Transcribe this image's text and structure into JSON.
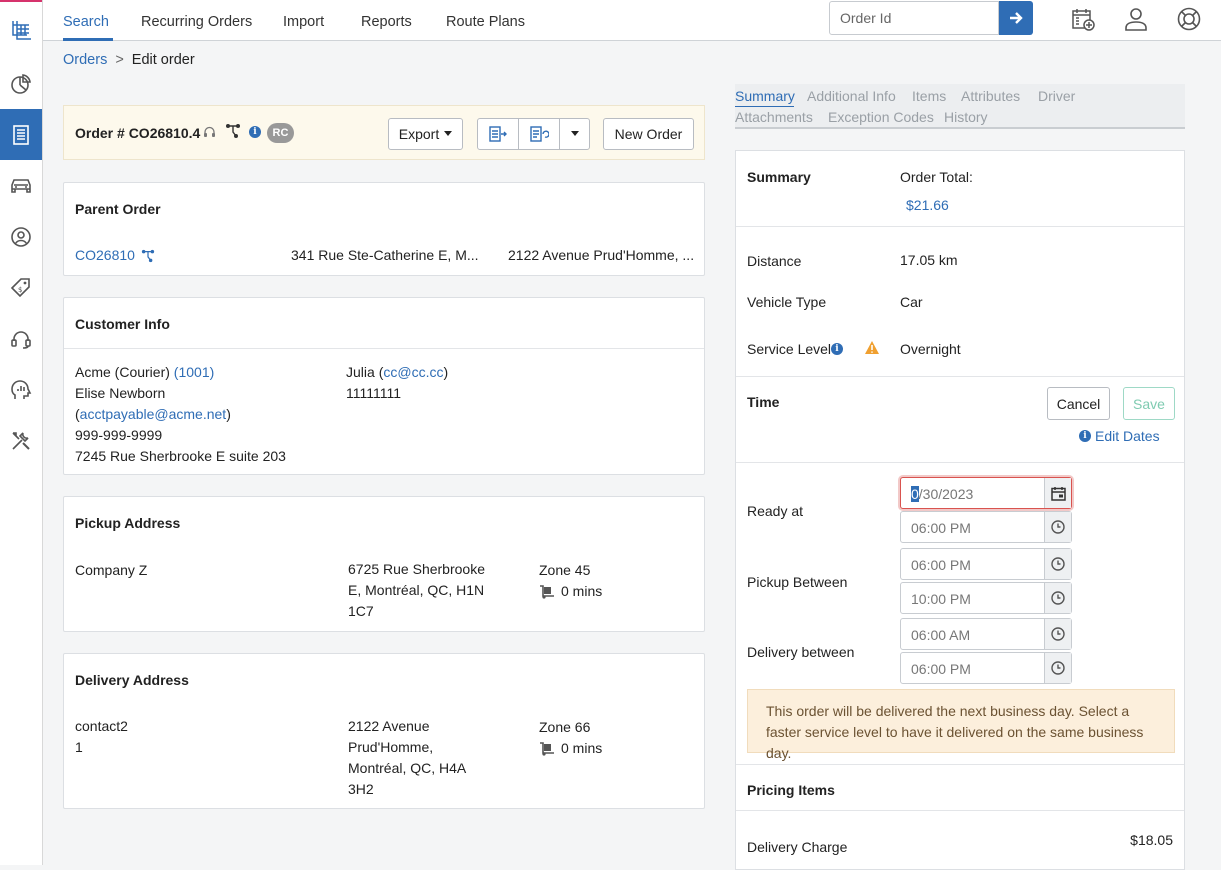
{
  "nav": {
    "tabs": [
      {
        "label": "Search"
      },
      {
        "label": "Recurring Orders"
      },
      {
        "label": "Import"
      },
      {
        "label": "Reports"
      },
      {
        "label": "Route Plans"
      }
    ],
    "order_id_placeholder": "Order Id"
  },
  "breadcrumb": {
    "root": "Orders",
    "separator": ">",
    "current": "Edit order"
  },
  "order_header": {
    "title": "Order # CO26810.4",
    "badge": "RC",
    "export_label": "Export",
    "new_order_label": "New Order"
  },
  "parent_order": {
    "heading": "Parent Order",
    "order_link": "CO26810",
    "pickup_address": "341 Rue Ste-Catherine E, M...",
    "delivery_address": "2122 Avenue Prud'Homme, ..."
  },
  "customer_info": {
    "heading": "Customer Info",
    "company": "Acme (Courier)",
    "account": "(1001)",
    "contact_name": "Elise Newborn",
    "email_open": "(",
    "email": "acctpayable@acme.net",
    "email_close": ")",
    "phone": "999-999-9999",
    "address": "7245 Rue Sherbrooke E suite 203",
    "caller_name": "Julia",
    "caller_open": "(",
    "caller_email": "cc@cc.cc",
    "caller_close": ")",
    "caller_phone": "11111111"
  },
  "pickup": {
    "heading": "Pickup Address",
    "name": "Company Z",
    "address_lines": [
      "6725 Rue Sherbrooke",
      "E, Montréal, QC, H1N",
      "1C7"
    ],
    "zone": "Zone 45",
    "wait": "0 mins"
  },
  "delivery": {
    "heading": "Delivery Address",
    "name": "contact2",
    "name_line2": "1",
    "address_lines": [
      "2122 Avenue",
      "Prud'Homme,",
      "Montréal, QC, H4A",
      "3H2"
    ],
    "zone": "Zone 66",
    "wait": "0 mins"
  },
  "right_tabs": [
    {
      "label": "Summary"
    },
    {
      "label": "Additional Info"
    },
    {
      "label": "Items"
    },
    {
      "label": "Attributes"
    },
    {
      "label": "Driver"
    },
    {
      "label": "Attachments"
    },
    {
      "label": "Exception Codes"
    },
    {
      "label": "History"
    }
  ],
  "summary": {
    "heading": "Summary",
    "order_total_label": "Order Total:",
    "order_total": "$21.66",
    "distance_label": "Distance",
    "distance": "17.05 km",
    "vehicle_label": "Vehicle Type",
    "vehicle": "Car",
    "service_label": "Service Level",
    "service": "Overnight"
  },
  "time": {
    "heading": "Time",
    "cancel_label": "Cancel",
    "save_label": "Save",
    "edit_dates_label": "Edit Dates",
    "ready_label": "Ready at",
    "ready_date_sel": "0",
    "ready_date_rest": "/30/2023",
    "ready_time": "06:00 PM",
    "pickup_label": "Pickup Between",
    "pickup_from": "06:00 PM",
    "pickup_to": "10:00 PM",
    "delivery_label": "Delivery between",
    "delivery_from": "06:00 AM",
    "delivery_to": "06:00 PM",
    "alert": "This order will be delivered the next business day. Select a faster service level to have it delivered on the same business day."
  },
  "pricing": {
    "heading": "Pricing Items",
    "delivery_charge_label": "Delivery Charge",
    "delivery_charge": "$18.05"
  },
  "colors": {
    "accent": "#2f6db5",
    "header_bg": "#fdf9ec",
    "alert_bg": "#fcefdc",
    "warning": "#f0a030"
  }
}
